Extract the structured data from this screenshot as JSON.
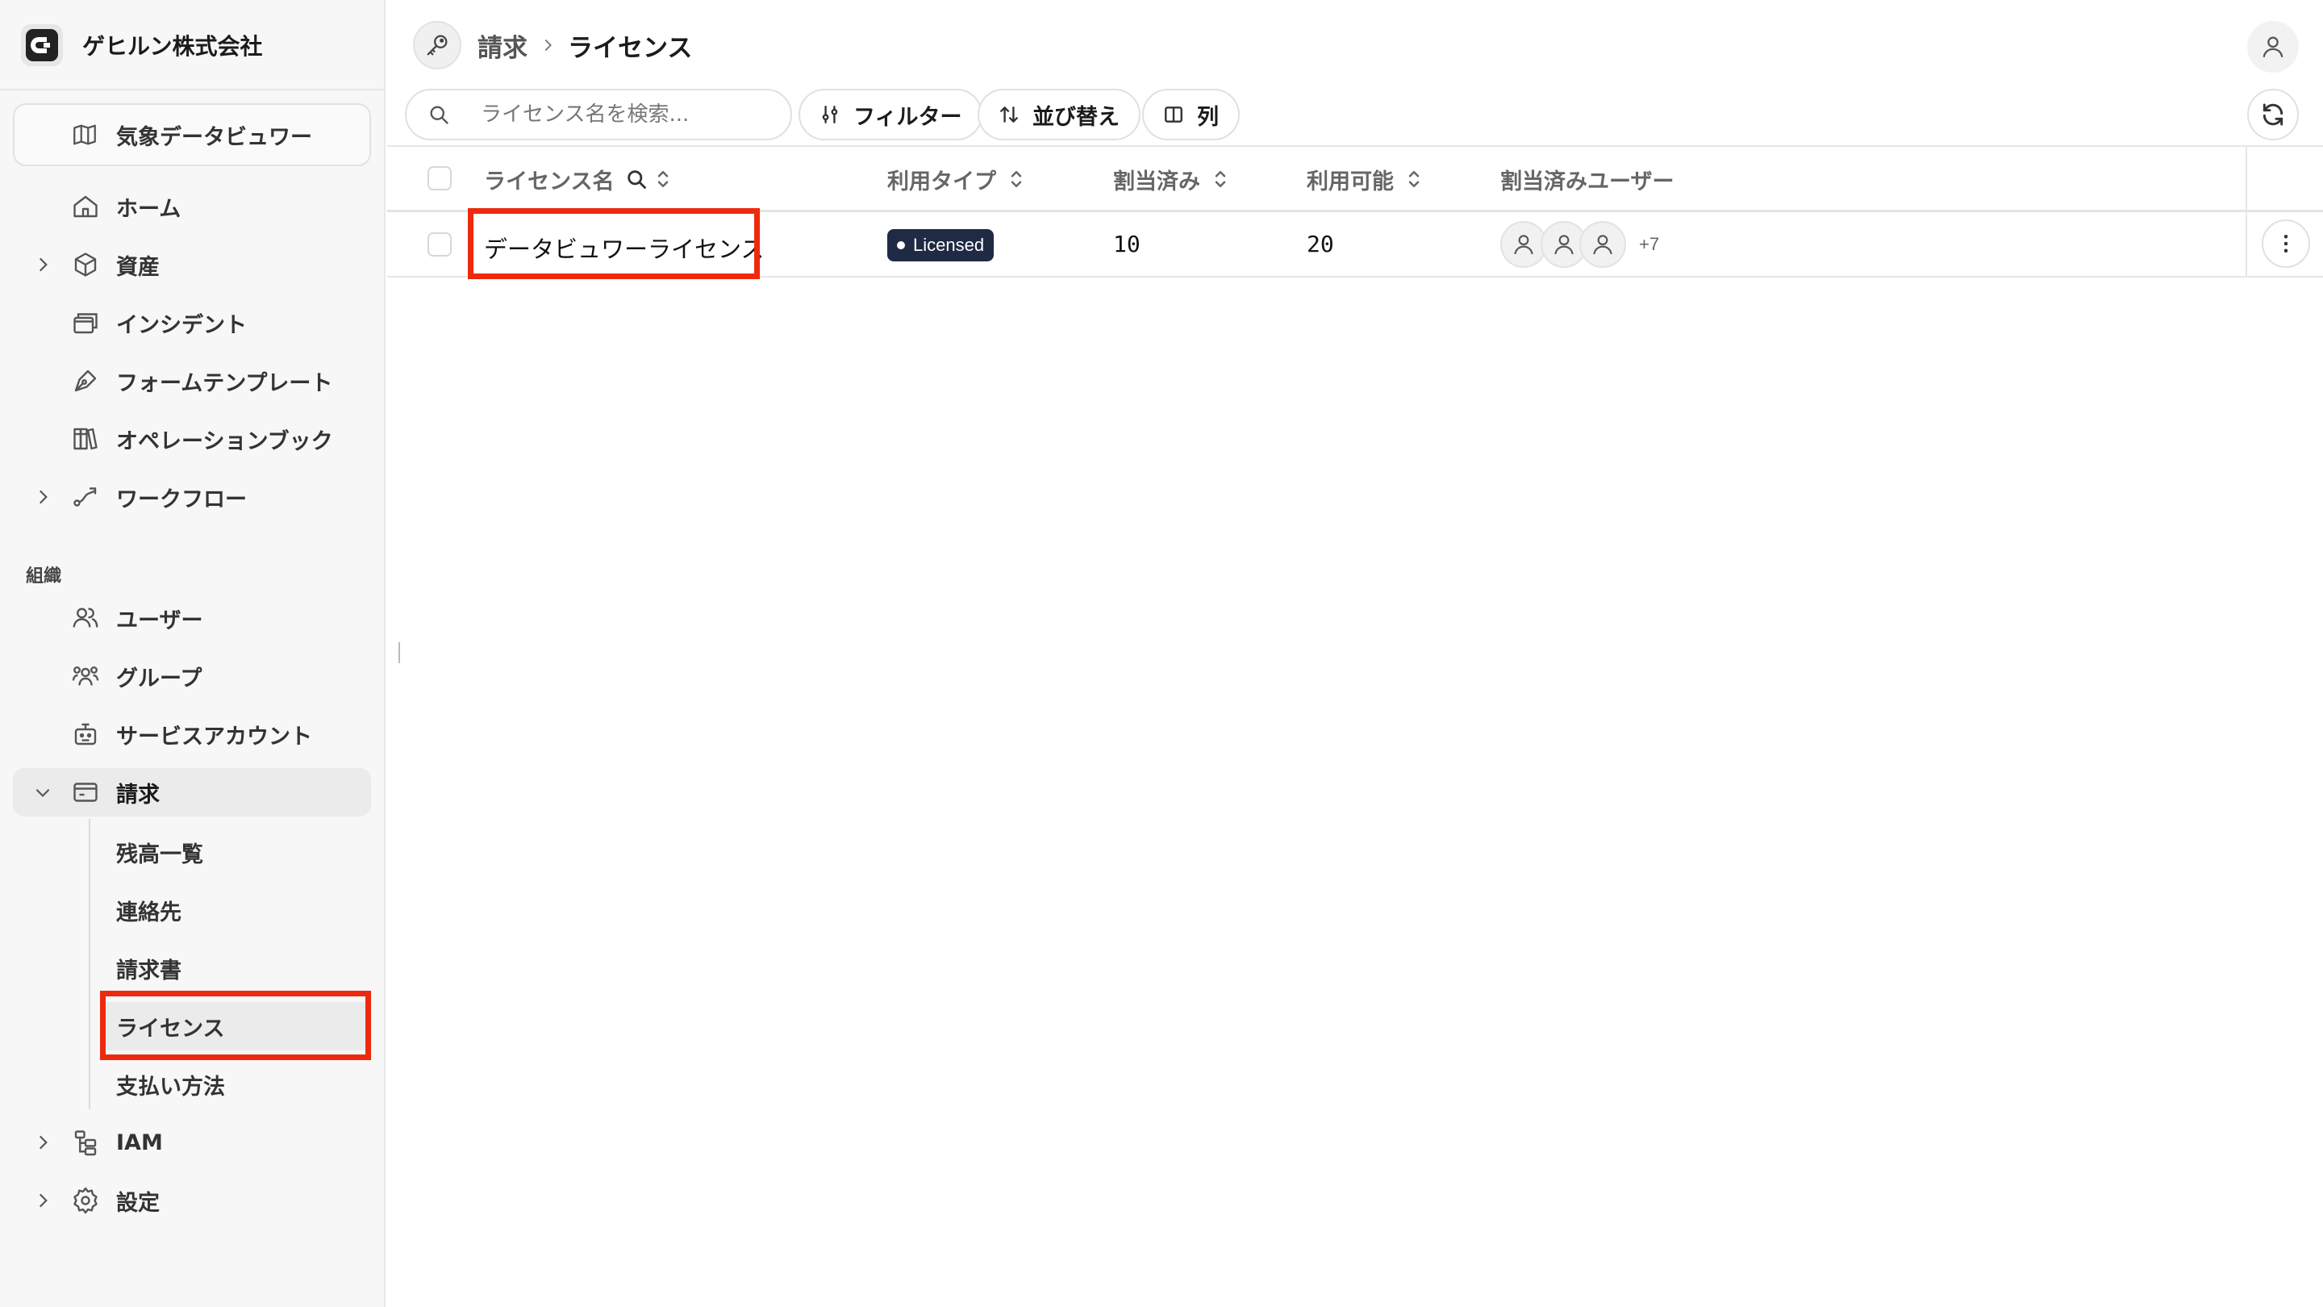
{
  "org": {
    "name": "ゲヒルン株式会社"
  },
  "app_switcher": {
    "label": "気象データビュワー"
  },
  "nav": {
    "home": "ホーム",
    "assets": "資産",
    "incidents": "インシデント",
    "form_templates": "フォームテンプレート",
    "operation_books": "オペレーションブック",
    "workflows": "ワークフロー",
    "org_section": "組織",
    "users": "ユーザー",
    "groups": "グループ",
    "service_accounts": "サービスアカウント",
    "billing": "請求",
    "billing_sub": {
      "balance": "残高一覧",
      "contacts": "連絡先",
      "invoices": "請求書",
      "licenses": "ライセンス",
      "payment": "支払い方法"
    },
    "iam": "IAM",
    "settings": "設定"
  },
  "breadcrumb": {
    "parent": "請求",
    "current": "ライセンス"
  },
  "toolbar": {
    "search_placeholder": "ライセンス名を検索...",
    "filter": "フィルター",
    "sort": "並び替え",
    "columns": "列"
  },
  "table": {
    "headers": {
      "name": "ライセンス名",
      "type": "利用タイプ",
      "assigned": "割当済み",
      "available": "利用可能",
      "users": "割当済みユーザー"
    },
    "rows": [
      {
        "name": "データビュワーライセンス",
        "type": "Licensed",
        "assigned": "10",
        "available": "20",
        "extra_users": "+7"
      }
    ]
  },
  "colors": {
    "highlight": "#ee2a0e",
    "badge_bg": "#1f2a44"
  }
}
